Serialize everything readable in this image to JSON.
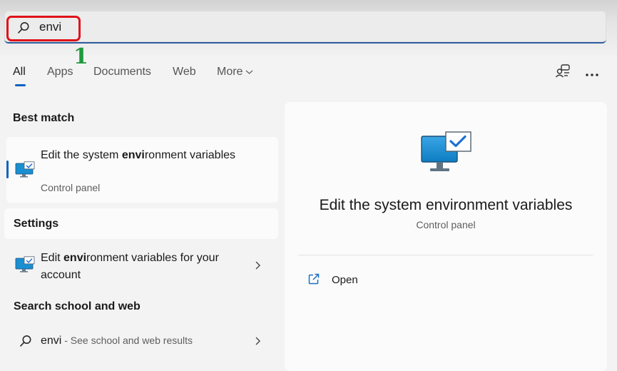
{
  "search": {
    "query": "envi",
    "annotation_number": "1"
  },
  "tabs": [
    {
      "label": "All",
      "active": true
    },
    {
      "label": "Apps"
    },
    {
      "label": "Documents"
    },
    {
      "label": "Web"
    },
    {
      "label": "More"
    }
  ],
  "header_icons": [
    "share-search-icon",
    "more-options-icon"
  ],
  "best_match": {
    "heading": "Best match",
    "title_before": "Edit the system ",
    "title_bold": "envi",
    "title_after": "ronment variables",
    "subtitle": "Control panel",
    "icon": "monitor-check-icon"
  },
  "settings": {
    "heading": "Settings",
    "title_before": "Edit ",
    "title_bold": "envi",
    "title_after": "ronment variables for your account",
    "icon": "monitor-check-icon"
  },
  "web_search": {
    "heading": "Search school and web",
    "query": "envi",
    "suffix": " - See school and web results"
  },
  "detail": {
    "title": "Edit the system environment variables",
    "subtitle": "Control panel",
    "actions": [
      {
        "label": "Open",
        "icon": "open-external-icon"
      }
    ]
  },
  "colors": {
    "accent": "#0f62c0",
    "highlight_box": "#e0121a",
    "annotation": "#1f9a3e"
  }
}
